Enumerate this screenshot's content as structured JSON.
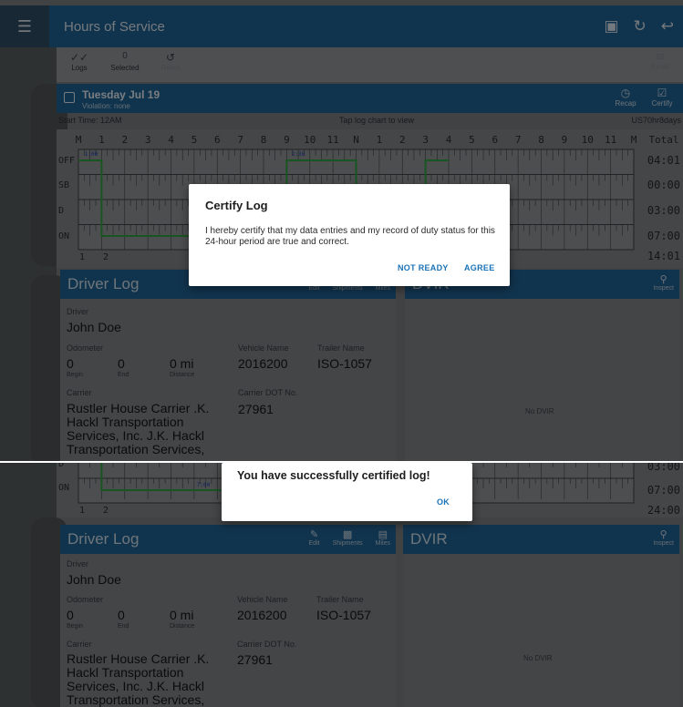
{
  "app": {
    "title": "Hours of Service",
    "actions": [
      "export-icon",
      "refresh-icon",
      "logout-icon"
    ]
  },
  "toolbar": {
    "logs_label": "Logs",
    "selected_count": "0",
    "selected_label": "Selected",
    "reset_label": "Reset",
    "email_label": "Email"
  },
  "day": {
    "date": "Tuesday Jul 19",
    "violation": "Violation: none",
    "recap_label": "Recap",
    "certify_label": "Certify"
  },
  "log_info": {
    "start_time": "Start Time: 12AM",
    "hint": "Tap log chart to view",
    "ruleset": "US70hr8days"
  },
  "graph": {
    "hour_labels": [
      "M",
      "1",
      "2",
      "3",
      "4",
      "5",
      "6",
      "7",
      "8",
      "9",
      "10",
      "11",
      "N",
      "1",
      "2",
      "3",
      "4",
      "5",
      "6",
      "7",
      "8",
      "9",
      "10",
      "11",
      "M"
    ],
    "total_label": "Total",
    "rows": [
      "OFF",
      "SB",
      "D",
      "ON"
    ],
    "totals_top": [
      "04:01",
      "00:00",
      "03:00",
      "07:00"
    ],
    "grand_total_top": "14:01",
    "totals_bottom": [
      "03:00",
      "07:00"
    ],
    "grand_total_bottom": "24:00",
    "marker_1": "1:00",
    "marker_2": "2:30",
    "marker_3": "7:00"
  },
  "driver_log": {
    "title": "Driver Log",
    "edit_label": "Edit",
    "shipments_label": "Shipments",
    "miles_label": "Miles",
    "driver_label": "Driver",
    "driver_name": "John Doe",
    "odometer_label": "Odometer",
    "begin_value": "0",
    "begin_label": "Begin",
    "end_value": "0",
    "end_label": "End",
    "distance_value": "0 mi",
    "distance_label": "Distance",
    "vehicle_label": "Vehicle Name",
    "vehicle_value": "2016200",
    "trailer_label": "Trailer Name",
    "trailer_value": "ISO-1057",
    "carrier_label": "Carrier",
    "carrier_value": "Rustler House Carrier .K. Hackl Transportation Services, Inc. J.K. Hackl Transportation Services,",
    "dot_label": "Carrier DOT No.",
    "dot_value": "27961"
  },
  "dvir": {
    "title": "DVIR",
    "inspect_label": "Inspect",
    "empty": "No DVIR"
  },
  "certify_dialog": {
    "title": "Certify Log",
    "message": "I hereby certify that my data entries and my record of duty status for this 24-hour period are true and correct.",
    "not_ready_label": "NOT READY",
    "agree_label": "AGREE"
  },
  "success_dialog": {
    "message": "You have successfully certified log!",
    "ok_label": "OK"
  },
  "colors": {
    "accent": "#1a73b8",
    "duty_line": "#2e9b3c"
  }
}
